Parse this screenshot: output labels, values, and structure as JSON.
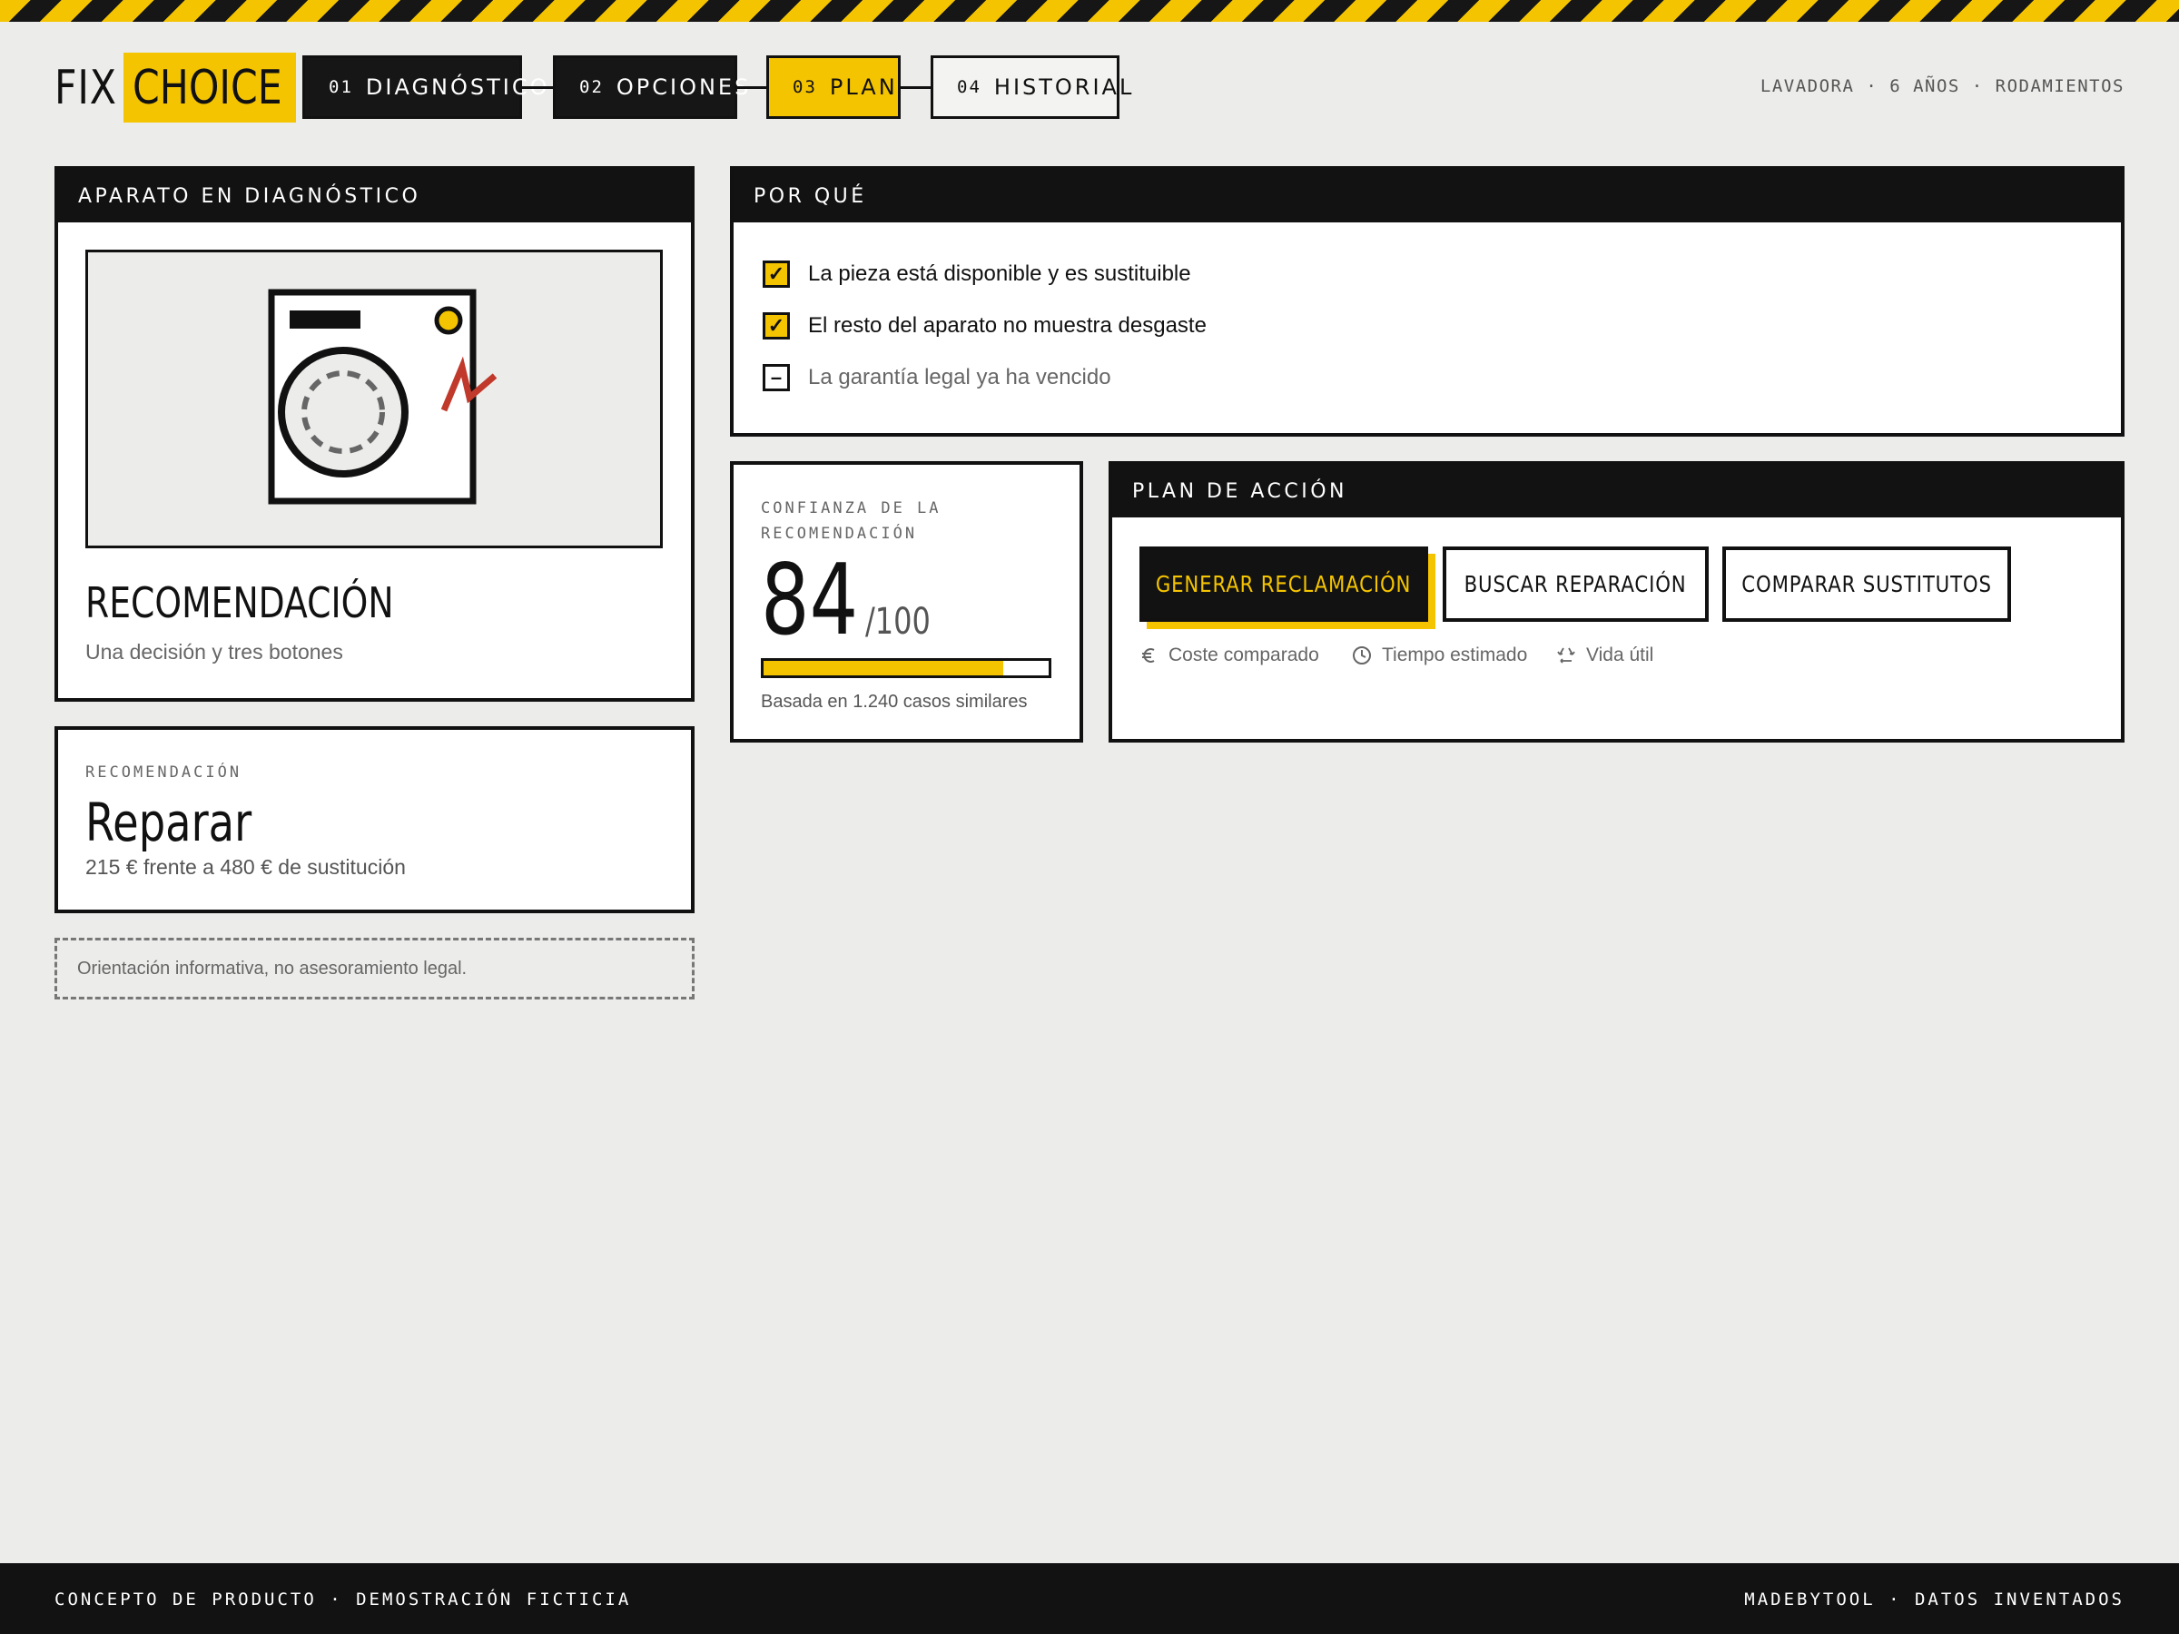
{
  "brand": {
    "part1": "FIX",
    "part2": "CHOICE",
    "accent": "#f5c400",
    "dark": "#121212"
  },
  "steps": [
    {
      "num": "01",
      "label": "DIAGNÓSTICO",
      "state": "done"
    },
    {
      "num": "02",
      "label": "OPCIONES",
      "state": "done"
    },
    {
      "num": "03",
      "label": "PLAN",
      "state": "active"
    },
    {
      "num": "04",
      "label": "HISTORIAL",
      "state": "pending"
    }
  ],
  "context": "LAVADORA · 6 AÑOS · RODAMIENTOS",
  "appliance": {
    "header": "APARATO EN DIAGNÓSTICO",
    "icon": "washing-machine-fault-icon",
    "title": "RECOMENDACIÓN",
    "subtitle": "Una decisión y tres botones"
  },
  "verdict": {
    "label": "RECOMENDACIÓN",
    "value": "Reparar",
    "detail": "215 € frente a 480 € de sustitución"
  },
  "disclaimer": "Orientación informativa, no asesoramiento legal.",
  "reasons": {
    "header": "POR QUÉ",
    "items": [
      {
        "text": "La pieza está disponible y es sustituible",
        "checked": true,
        "mark": "✓"
      },
      {
        "text": "El resto del aparato no muestra desgaste",
        "checked": true,
        "mark": "✓"
      },
      {
        "text": "La garantía legal ya ha vencido",
        "checked": false,
        "mark": "–"
      }
    ]
  },
  "confidence": {
    "label_line1": "CONFIANZA DE LA",
    "label_line2": "RECOMENDACIÓN",
    "score": "84",
    "max": "/100",
    "fraction": 0.84,
    "basis": "Basada en 1.240 casos similares"
  },
  "action_plan": {
    "header": "PLAN DE ACCIÓN",
    "buttons": {
      "primary": "GENERAR RECLAMACIÓN",
      "secondary": "BUSCAR REPARACIÓN",
      "tertiary": "COMPARAR SUSTITUTOS"
    },
    "meta": [
      {
        "icon": "euro-icon",
        "label": "Coste comparado"
      },
      {
        "icon": "clock-icon",
        "label": "Tiempo estimado"
      },
      {
        "icon": "recycle-icon",
        "label": "Vida útil"
      }
    ]
  },
  "footer": {
    "left": "CONCEPTO DE PRODUCTO · DEMOSTRACIÓN FICTICIA",
    "right": "MADEBYTOOL · DATOS INVENTADOS"
  }
}
